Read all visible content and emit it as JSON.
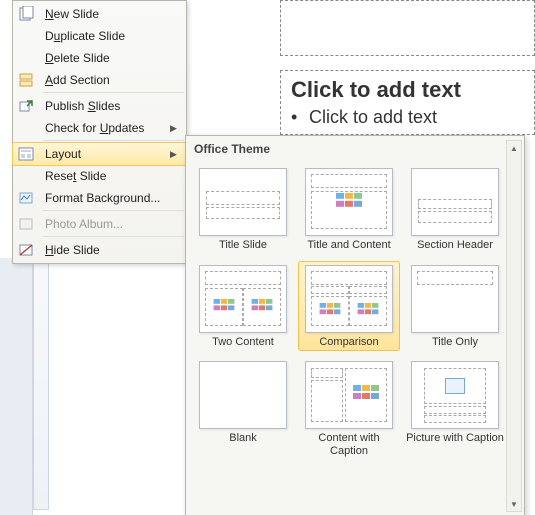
{
  "slide": {
    "title_placeholder": "Click to add text",
    "body_placeholder": "Click to add text"
  },
  "menu": {
    "new_slide": "New Slide",
    "duplicate_slide": "Duplicate Slide",
    "delete_slide": "Delete Slide",
    "add_section": "Add Section",
    "publish_slides": "Publish Slides",
    "check_updates": "Check for Updates",
    "layout": "Layout",
    "reset_slide": "Reset Slide",
    "format_background": "Format Background...",
    "photo_album": "Photo Album...",
    "hide_slide": "Hide Slide"
  },
  "gallery": {
    "header": "Office Theme",
    "items": [
      {
        "label": "Title Slide"
      },
      {
        "label": "Title and Content"
      },
      {
        "label": "Section Header"
      },
      {
        "label": "Two Content"
      },
      {
        "label": "Comparison"
      },
      {
        "label": "Title Only"
      },
      {
        "label": "Blank"
      },
      {
        "label": "Content with Caption"
      },
      {
        "label": "Picture with Caption"
      }
    ],
    "selected_index": 4
  }
}
